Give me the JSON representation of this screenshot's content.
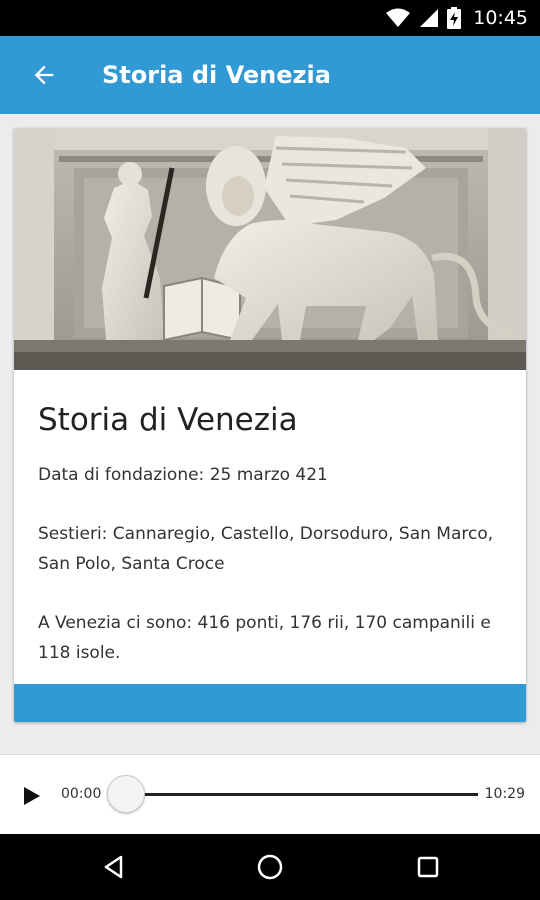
{
  "status_bar": {
    "time": "10:45",
    "icons": [
      "wifi-icon",
      "signal-icon",
      "battery-charging-icon"
    ]
  },
  "app_bar": {
    "title": "Storia di Venezia",
    "back_icon": "arrow-back-icon",
    "color": "#3199d4"
  },
  "card": {
    "image": "winged-lion-relief-image",
    "title": "Storia di Venezia",
    "founded": "Data di fondazione: 25 marzo 421",
    "sestieri": "Sestieri: Cannaregio, Castello, Dorsoduro, San Marco, San Polo, Santa Croce",
    "facts": "A Venezia ci sono: 416 ponti, 176 rii, 170 campanili e 118 isole."
  },
  "player": {
    "play_icon": "play-icon",
    "current_time": "00:00",
    "total_time": "10:29",
    "progress": 0
  },
  "nav_bar": {
    "icons": [
      "back-triangle-icon",
      "home-circle-icon",
      "recents-square-icon"
    ]
  }
}
